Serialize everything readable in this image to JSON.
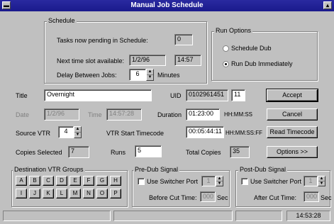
{
  "window": {
    "title": "Manual Job Schedule",
    "sysmenu": "▬",
    "maxbtn": "▴"
  },
  "schedule": {
    "group_title": "Schedule",
    "tasks_label": "Tasks now pending in Schedule:",
    "tasks_value": "0",
    "next_label": "Next time slot available:",
    "next_date": "1/2/96",
    "next_time": "14:57",
    "delay_label": "Delay Between Jobs:",
    "delay_value": "6",
    "delay_unit": "Minutes"
  },
  "run_options": {
    "title": "Run Options",
    "schedule_dub": "Schedule Dub",
    "run_immediately": "Run Dub Immediately",
    "selected": "run_immediately"
  },
  "job": {
    "title_label": "Title",
    "title_value": "Overnight",
    "uid_label": "UID",
    "uid_value": "0102961451",
    "uid_suffix": "11",
    "date_label": "Date",
    "date_value": "1/2/96",
    "time_label": "Time",
    "time_value": "14:57:28",
    "duration_label": "Duration",
    "duration_value": "01:23:00",
    "duration_fmt": "HH:MM:SS",
    "source_label": "Source VTR",
    "source_value": "4",
    "start_tc_label": "VTR Start Timecode",
    "start_tc_value": "00:05:44:11",
    "start_tc_fmt": "HH:MM:SS:FF",
    "copies_selected_label": "Copies Selected",
    "copies_selected_value": "7",
    "runs_label": "Runs",
    "runs_value": "5",
    "total_copies_label": "Total Copies",
    "total_copies_value": "35"
  },
  "buttons": {
    "accept": "Accept",
    "cancel": "Cancel",
    "read_timecode": "Read Timecode",
    "options": "Options >>"
  },
  "dest_groups": {
    "title": "Destination VTR Groups",
    "row1": [
      "A",
      "B",
      "C",
      "D",
      "E",
      "F",
      "G",
      "H"
    ],
    "row2": [
      "I",
      "J",
      "K",
      "L",
      "M",
      "N",
      "O",
      "P"
    ]
  },
  "pre_dub": {
    "title": "Pre-Dub Signal",
    "use_switcher": "Use Switcher Port",
    "port_value": "1",
    "cut_label": "Before Cut Time:",
    "cut_value": "000",
    "cut_unit": "Sec"
  },
  "post_dub": {
    "title": "Post-Dub Signal",
    "use_switcher": "Use Switcher Port",
    "port_value": "1",
    "cut_label": "After Cut Time:",
    "cut_value": "000",
    "cut_unit": "Sec"
  },
  "status": {
    "clock": "14:53:28"
  },
  "colors": {
    "titlebar": "#1a1a8c",
    "face": "#c0c0c0"
  }
}
